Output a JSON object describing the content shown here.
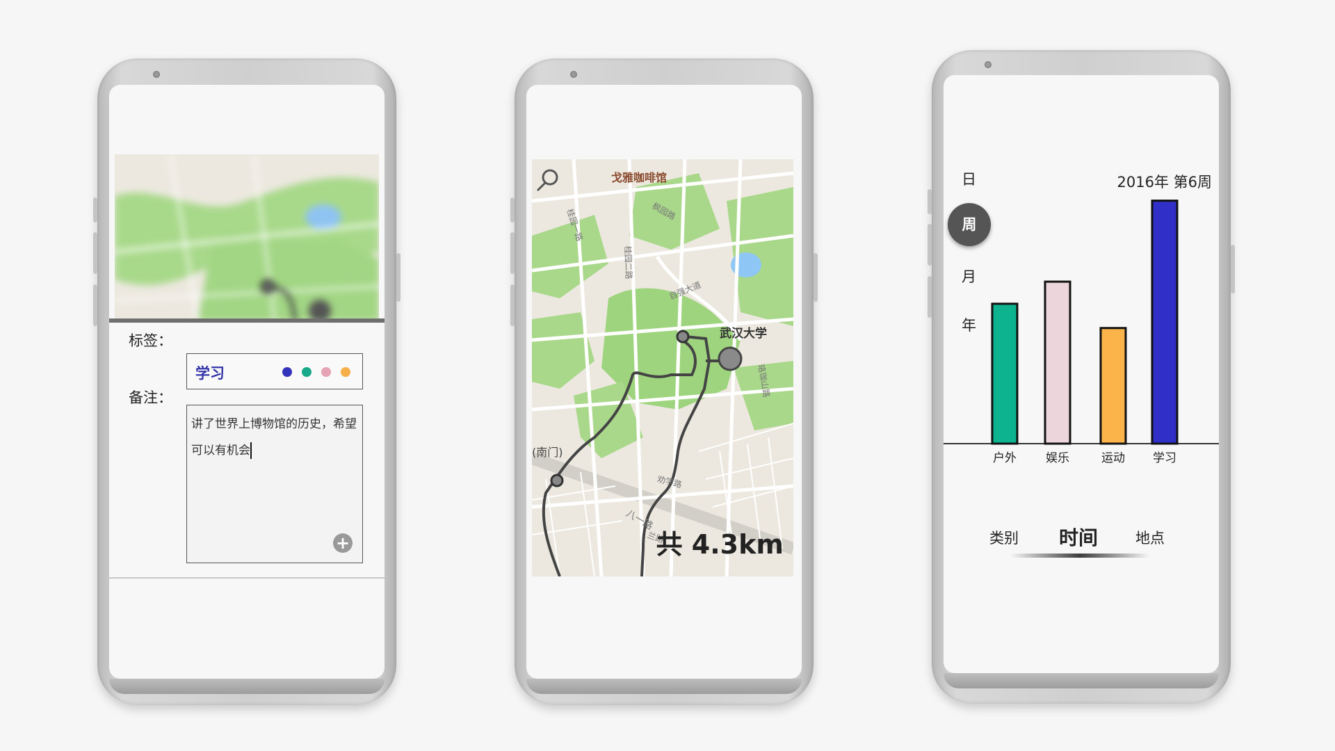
{
  "screen1": {
    "tag_label": "标签：",
    "tag_value": "学习",
    "tag_colors": [
      "#3333bb",
      "#1aa88a",
      "#e6a3b5",
      "#f5b04a"
    ],
    "note_label": "备注：",
    "note_text": "讲了世界上博物馆的历史，希望可以有机会",
    "add_icon": "plus-circle-icon"
  },
  "screen2": {
    "map_labels": {
      "cafe": "戈雅咖啡馆",
      "university": "武汉大学",
      "gate": "(南门)",
      "road1": "桂园一路",
      "road2": "桂园二路",
      "road3": "枫园路",
      "road4": "自强大道",
      "road5": "八一路",
      "road6": "珞珈山路",
      "road7": "劝学路",
      "road8": "兰路"
    },
    "distance": "共 4.3km"
  },
  "screen3": {
    "title": "2016年 第6周",
    "periods": [
      "日",
      "周",
      "月",
      "年"
    ],
    "active_period": "周",
    "tabs": [
      "类别",
      "时间",
      "地点"
    ],
    "active_tab": "时间",
    "chart_data": {
      "type": "bar",
      "categories": [
        "户外",
        "娱乐",
        "运动",
        "学习"
      ],
      "values": [
        190,
        220,
        157,
        330
      ],
      "colors": [
        "#0db38f",
        "#ecd6dc",
        "#fbb44a",
        "#3030c8"
      ],
      "title": "2016年 第6周",
      "xlabel": "",
      "ylabel": "",
      "ylim": [
        0,
        340
      ],
      "grid": false
    }
  }
}
